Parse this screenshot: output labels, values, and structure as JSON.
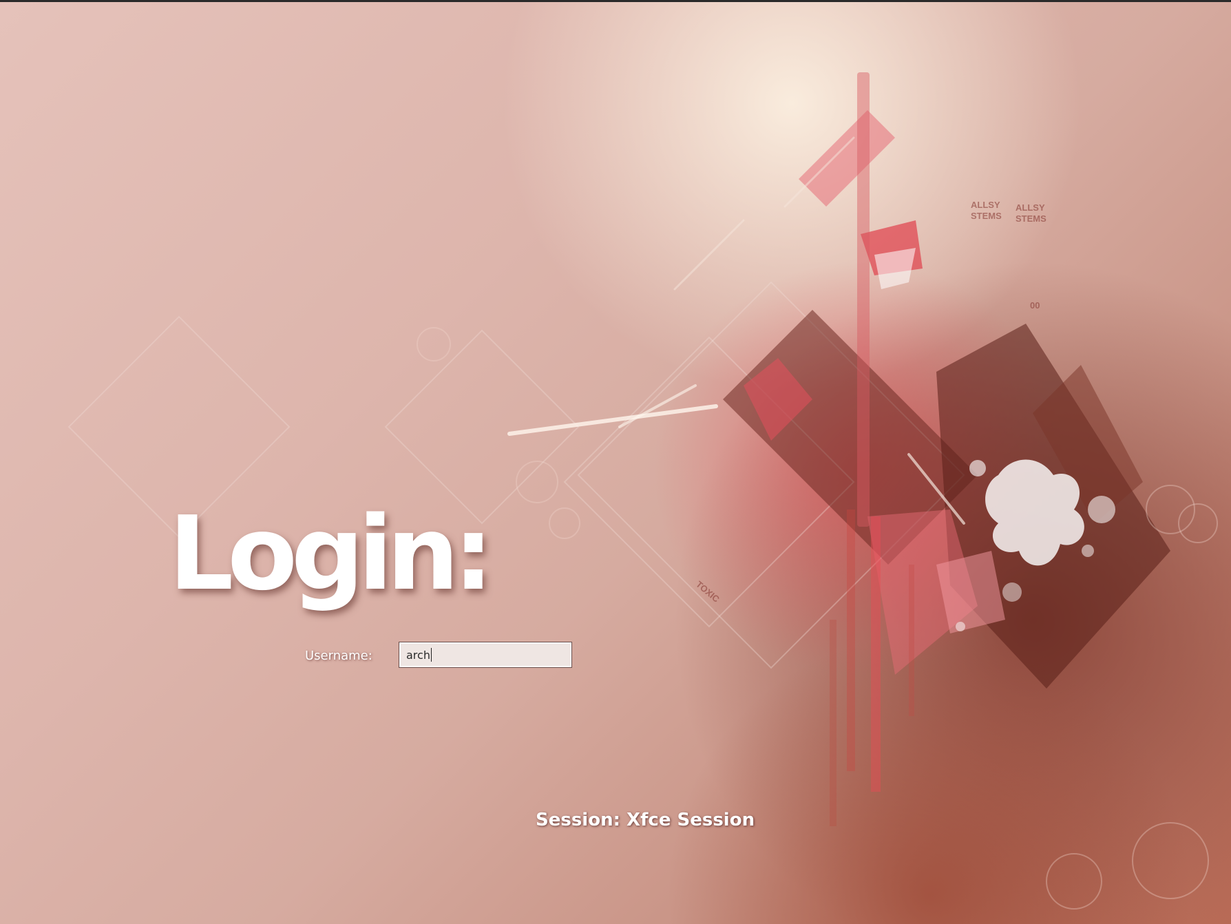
{
  "login": {
    "title": "Login:",
    "username_label": "Username:",
    "username_value": "arch"
  },
  "session": {
    "label": "Session: Xfce Session"
  },
  "wallpaper": {
    "text_marks": [
      "ALLSY",
      "ALLSY",
      "STEMS",
      "STEMS",
      "00",
      "TOXIC"
    ]
  },
  "colors": {
    "background_light": "#e5c2ba",
    "background_mid": "#d6aba0",
    "accent_red": "#d9404a",
    "accent_dark": "#6e2a22",
    "text_white": "#ffffff"
  }
}
